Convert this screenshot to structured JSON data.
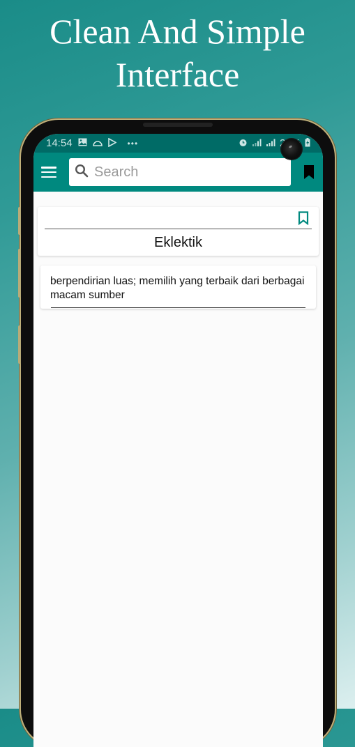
{
  "promo": {
    "headline_line1": "Clean And Simple",
    "headline_line2": "Interface"
  },
  "statusbar": {
    "time": "14:54",
    "left_icons": [
      "image-icon",
      "cloud-icon",
      "play-store-icon",
      "more-dots-icon"
    ],
    "right_icons": [
      "alarm-icon",
      "signal-icon",
      "signal-icon"
    ],
    "battery": "27%"
  },
  "appbar": {
    "menu_icon": "hamburger-menu-icon",
    "search_placeholder": "Search",
    "search_value": "",
    "bookmarks_icon": "bookmark-filled-icon"
  },
  "colors": {
    "primary": "#00897f",
    "primary_dark": "#006b66",
    "accent": "#00897f"
  },
  "entry": {
    "word": "Eklektik",
    "bookmark_icon": "bookmark-outline-icon",
    "definition": "berpendirian luas; memilih yang terbaik dari berbagai macam sumber"
  }
}
